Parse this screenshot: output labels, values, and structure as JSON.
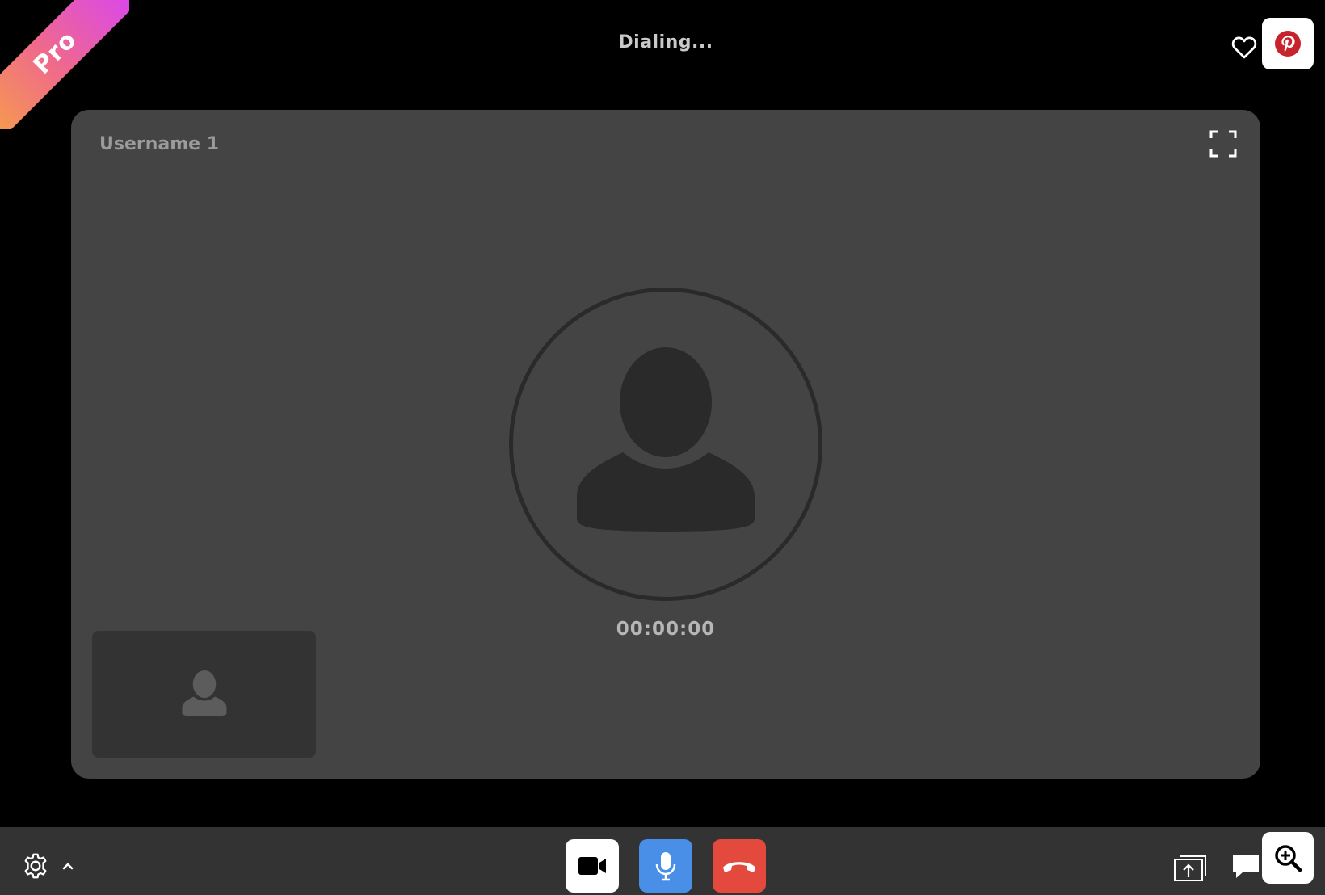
{
  "badge": {
    "label": "Pro"
  },
  "header": {
    "status": "Dialing...",
    "favorite_icon": "heart-icon",
    "pin_icon": "pinterest-icon"
  },
  "remote": {
    "name": "Username 1",
    "timer": "00:00:00",
    "avatar_icon": "user-avatar-icon",
    "fullscreen_icon": "fullscreen-icon"
  },
  "local": {
    "avatar_icon": "user-avatar-icon"
  },
  "controls": {
    "settings_icon": "gear-icon",
    "settings_menu_icon": "chevron-up-icon",
    "camera_icon": "video-camera-icon",
    "mic_icon": "microphone-icon",
    "hangup_icon": "phone-hangup-icon",
    "share_icon": "screen-share-icon",
    "chat_icon": "chat-bubble-icon",
    "zoom_icon": "zoom-in-icon"
  },
  "colors": {
    "background": "#000000",
    "panel": "#444444",
    "control_bar": "#333333",
    "mic_active": "#4a8fe7",
    "hangup": "#e34a3d",
    "pinterest": "#c8232c"
  }
}
